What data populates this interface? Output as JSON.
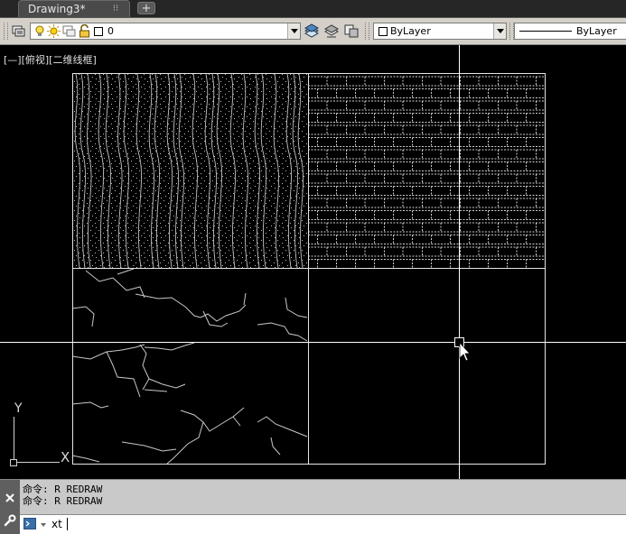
{
  "tabs": [
    {
      "label": "Drawing3*",
      "close_glyph": "⁝⁝"
    }
  ],
  "tab_add_glyph": "+",
  "layer_toolbar": {
    "layer_name": "0",
    "color_value": "ByLayer",
    "linetype_value": "ByLayer"
  },
  "viewport": {
    "label": "[—][俯视][二维线框]"
  },
  "ucs": {
    "x_label": "X",
    "y_label": "Y"
  },
  "command": {
    "history": [
      "命令: R REDRAW",
      "命令: R REDRAW"
    ],
    "input_value": "xt"
  },
  "colors": {
    "canvas": "#000000",
    "hatch": "#c8c8c8",
    "crosshair": "#ffffff"
  },
  "icons": {
    "layer_manager": "layer-properties-icon",
    "close": "close-icon",
    "settings": "wrench-icon",
    "prompt": "command-prompt-icon"
  }
}
